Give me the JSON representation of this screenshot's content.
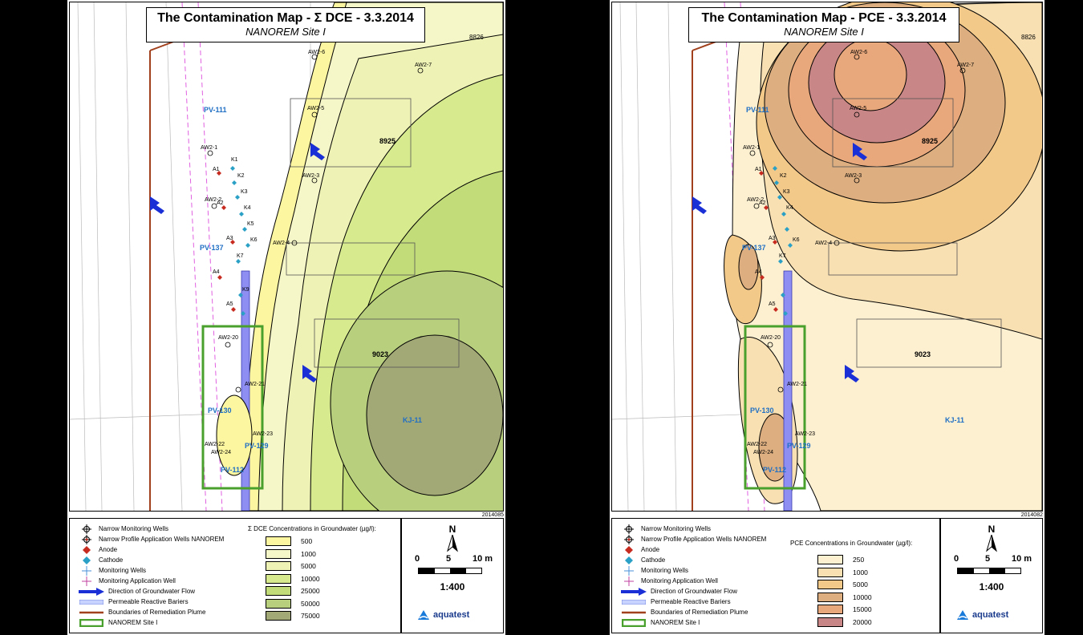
{
  "left": {
    "title": "The Contamination Map - Σ DCE - 3.3.2014",
    "subtitle": "NANOREM Site I",
    "map_code": "2014085",
    "concentration_title": "Σ DCE Concentrations in Groundwater (µg/l):",
    "concentrations": [
      {
        "label": "500",
        "color": "#fdf6a0"
      },
      {
        "label": "1000",
        "color": "#f6f7c8"
      },
      {
        "label": "5000",
        "color": "#eef2b4"
      },
      {
        "label": "10000",
        "color": "#d7eb8e"
      },
      {
        "label": "25000",
        "color": "#c3dc7a"
      },
      {
        "label": "50000",
        "color": "#b8cf7e"
      },
      {
        "label": "75000",
        "color": "#a3a877"
      }
    ]
  },
  "right": {
    "title": "The Contamination Map - PCE - 3.3.2014",
    "subtitle": "NANOREM Site I",
    "map_code": "2014082",
    "concentration_title": "PCE Concentrations in Groundwater (µg/l):",
    "concentrations": [
      {
        "label": "250",
        "color": "#fdf0d0"
      },
      {
        "label": "1000",
        "color": "#f8e0b2"
      },
      {
        "label": "5000",
        "color": "#f3c98a"
      },
      {
        "label": "10000",
        "color": "#dcae80"
      },
      {
        "label": "15000",
        "color": "#e9a87c"
      },
      {
        "label": "20000",
        "color": "#c98686"
      }
    ]
  },
  "legend_items": [
    {
      "label": "Narrow Monitoring Wells",
      "icon": "narrow-monitoring-well-icon"
    },
    {
      "label": "Narrow Profile Application Wells NANOREM",
      "icon": "application-well-icon"
    },
    {
      "label": "Anode",
      "icon": "anode-icon"
    },
    {
      "label": "Cathode",
      "icon": "cathode-icon"
    },
    {
      "label": "Monitoring Wells",
      "icon": "monitoring-well-icon"
    },
    {
      "label": "Monitoring Application Well",
      "icon": "monitoring-application-well-icon"
    },
    {
      "label": "Direction of Groundwater Flow",
      "icon": "flow-arrow-icon"
    },
    {
      "label": "Permeable Reactive Bariers",
      "icon": "hatched-barrier-icon"
    },
    {
      "label": "Boundaries of Remediation Plume",
      "icon": "plume-boundary-line-icon"
    },
    {
      "label": "NANOREM Site I",
      "icon": "site-boundary-rect-icon"
    }
  ],
  "scale": {
    "north": "N",
    "tick0": "0",
    "tick1": "5",
    "tick2": "10 m",
    "ratio": "1:400"
  },
  "logo_text": "aquatest",
  "map_labels": {
    "wells": [
      "AW2-6",
      "AW2-7",
      "AW2-5",
      "AW2-1",
      "AW2-2",
      "AW2-3",
      "AW2-4",
      "AW2-20",
      "AW2-21",
      "AW2-23",
      "AW2-22",
      "AW2-24"
    ],
    "anodes": [
      "A1",
      "A2",
      "A3",
      "A4",
      "A5"
    ],
    "cathodes": [
      "K1",
      "K2",
      "K3",
      "K4",
      "K5",
      "K6",
      "K7",
      "K8",
      "K9"
    ],
    "monitoring": [
      "PV-111",
      "PV-137",
      "PV-130",
      "PV-129",
      "PV-112",
      "KJ-11"
    ],
    "buildings": [
      "8826",
      "8925",
      "9023"
    ]
  },
  "colors": {
    "flow_arrow": "#1a2fd6",
    "site_boundary": "#4aa02c",
    "plume_boundary": "#a0401c",
    "label_blue": "#1f6fc4"
  }
}
